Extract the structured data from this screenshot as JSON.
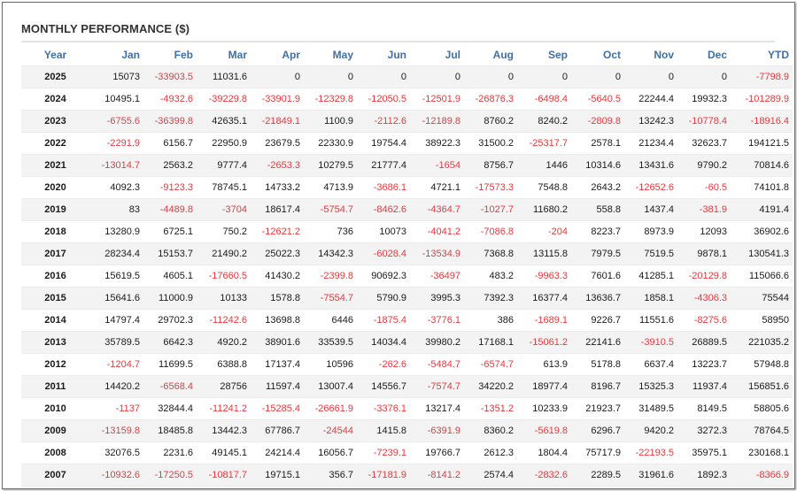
{
  "panel": {
    "title": "MONTHLY PERFORMANCE ($)"
  },
  "colors": {
    "header_text": "#3f6fa6",
    "negative": "#e8393e",
    "positive": "#1a1a1a",
    "stripe": "#f3f3f3"
  },
  "table": {
    "columns": [
      "Year",
      "Jan",
      "Feb",
      "Mar",
      "Apr",
      "May",
      "Jun",
      "Jul",
      "Aug",
      "Sep",
      "Oct",
      "Nov",
      "Dec",
      "YTD"
    ],
    "rows": [
      [
        "2025",
        "15073",
        "-33903.5",
        "11031.6",
        "0",
        "0",
        "0",
        "0",
        "0",
        "0",
        "0",
        "0",
        "0",
        "-7798.9"
      ],
      [
        "2024",
        "10495.1",
        "-4932.6",
        "-39229.8",
        "-33901.9",
        "-12329.8",
        "-12050.5",
        "-12501.9",
        "-26876.3",
        "-6498.4",
        "-5640.5",
        "22244.4",
        "19932.3",
        "-101289.9"
      ],
      [
        "2023",
        "-6755.6",
        "-36399.8",
        "42635.1",
        "-21849.1",
        "1100.9",
        "-2112.6",
        "-12189.8",
        "8760.2",
        "8240.2",
        "-2809.8",
        "13242.3",
        "-10778.4",
        "-18916.4"
      ],
      [
        "2022",
        "-2291.9",
        "6156.7",
        "22950.9",
        "23679.5",
        "22330.9",
        "19754.4",
        "38922.3",
        "31500.2",
        "-25317.7",
        "2578.1",
        "21234.4",
        "32623.7",
        "194121.5"
      ],
      [
        "2021",
        "-13014.7",
        "2563.2",
        "9777.4",
        "-2653.3",
        "10279.5",
        "21777.4",
        "-1654",
        "8756.7",
        "1446",
        "10314.6",
        "13431.6",
        "9790.2",
        "70814.6"
      ],
      [
        "2020",
        "4092.3",
        "-9123.3",
        "78745.1",
        "14733.2",
        "4713.9",
        "-3686.1",
        "4721.1",
        "-17573.3",
        "7548.8",
        "2643.2",
        "-12652.6",
        "-60.5",
        "74101.8"
      ],
      [
        "2019",
        "83",
        "-4489.8",
        "-3704",
        "18617.4",
        "-5754.7",
        "-8462.6",
        "-4364.7",
        "-1027.7",
        "11680.2",
        "558.8",
        "1437.4",
        "-381.9",
        "4191.4"
      ],
      [
        "2018",
        "13280.9",
        "6725.1",
        "750.2",
        "-12621.2",
        "736",
        "10073",
        "-4041.2",
        "-7086.8",
        "-204",
        "8223.7",
        "8973.9",
        "12093",
        "36902.6"
      ],
      [
        "2017",
        "28234.4",
        "15153.7",
        "21490.2",
        "25022.3",
        "14342.3",
        "-6028.4",
        "-13534.9",
        "7368.8",
        "13115.8",
        "7979.5",
        "7519.5",
        "9878.1",
        "130541.3"
      ],
      [
        "2016",
        "15619.5",
        "4605.1",
        "-17660.5",
        "41430.2",
        "-2399.8",
        "90692.3",
        "-36497",
        "483.2",
        "-9963.3",
        "7601.6",
        "41285.1",
        "-20129.8",
        "115066.6"
      ],
      [
        "2015",
        "15641.6",
        "11000.9",
        "10133",
        "1578.8",
        "-7554.7",
        "5790.9",
        "3995.3",
        "7392.3",
        "16377.4",
        "13636.7",
        "1858.1",
        "-4306.3",
        "75544"
      ],
      [
        "2014",
        "14797.4",
        "29702.3",
        "-11242.6",
        "13698.8",
        "6446",
        "-1875.4",
        "-3776.1",
        "386",
        "-1689.1",
        "9226.7",
        "11551.6",
        "-8275.6",
        "58950"
      ],
      [
        "2013",
        "35789.5",
        "6642.3",
        "4920.2",
        "38901.6",
        "33539.5",
        "14034.4",
        "39980.2",
        "17168.1",
        "-15061.2",
        "22141.6",
        "-3910.5",
        "26889.5",
        "221035.2"
      ],
      [
        "2012",
        "-1204.7",
        "11699.5",
        "6388.8",
        "17137.4",
        "10596",
        "-262.6",
        "-5484.7",
        "-6574.7",
        "613.9",
        "5178.8",
        "6637.4",
        "13223.7",
        "57948.8"
      ],
      [
        "2011",
        "14420.2",
        "-6568.4",
        "28756",
        "11597.4",
        "13007.4",
        "14556.7",
        "-7574.7",
        "34220.2",
        "18977.4",
        "8196.7",
        "15325.3",
        "11937.4",
        "156851.6"
      ],
      [
        "2010",
        "-1137",
        "32844.4",
        "-11241.2",
        "-15285.4",
        "-26661.9",
        "-3376.1",
        "13217.4",
        "-1351.2",
        "10233.9",
        "21923.7",
        "31489.5",
        "8149.5",
        "58805.6"
      ],
      [
        "2009",
        "-13159.8",
        "18485.8",
        "13442.3",
        "67786.7",
        "-24544",
        "1415.8",
        "-6391.9",
        "8360.2",
        "-5619.8",
        "6296.7",
        "9420.2",
        "3272.3",
        "78764.5"
      ],
      [
        "2008",
        "32076.5",
        "2231.6",
        "49145.1",
        "24214.4",
        "16056.7",
        "-7239.1",
        "19766.7",
        "2612.3",
        "1804.4",
        "75717.9",
        "-22193.5",
        "35975.1",
        "230168.1"
      ],
      [
        "2007",
        "-10932.6",
        "-17250.5",
        "-10817.7",
        "19715.1",
        "356.7",
        "-17181.9",
        "-8141.2",
        "2574.4",
        "-2832.6",
        "2289.5",
        "31961.6",
        "1892.3",
        "-8366.9"
      ]
    ]
  }
}
